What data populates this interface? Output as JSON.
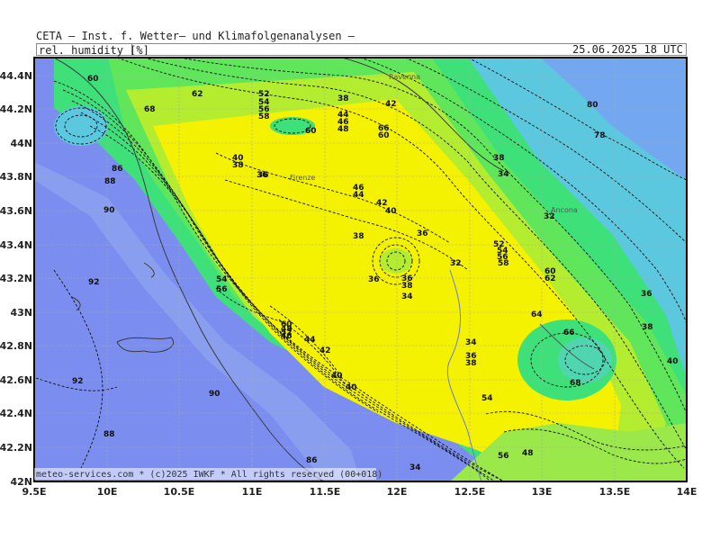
{
  "header": {
    "title": "CETA — Inst. f. Wetter— und Klimafolgenanalysen —",
    "parameter": "rel. humidity [%]",
    "datetime": "25.06.2025 18 UTC"
  },
  "map": {
    "lon_labels": [
      "9.5E",
      "10E",
      "10.5E",
      "11E",
      "11.5E",
      "12E",
      "12.5E",
      "13E",
      "13.5E",
      "14E"
    ],
    "lat_labels": [
      "44.4N",
      "44.2N",
      "44N",
      "43.8N",
      "43.6N",
      "43.4N",
      "43.2N",
      "43N",
      "42.8N",
      "42.6N",
      "42.4N",
      "42.2N",
      "42N"
    ],
    "contour_labels": [
      "60",
      "62",
      "68",
      "52",
      "54",
      "56",
      "58",
      "60",
      "38",
      "42",
      "44",
      "46",
      "48",
      "66",
      "60",
      "80",
      "78",
      "36",
      "40",
      "38",
      "86",
      "88",
      "90",
      "92",
      "46",
      "44",
      "42",
      "40",
      "38",
      "36",
      "38",
      "32",
      "34",
      "36",
      "38",
      "40",
      "52",
      "54",
      "56",
      "58",
      "60",
      "62",
      "64",
      "66",
      "68",
      "92",
      "90",
      "88",
      "86",
      "36",
      "34",
      "32",
      "34",
      "36",
      "38",
      "40",
      "54",
      "56",
      "60",
      "48",
      "54",
      "56",
      "52",
      "36",
      "34",
      "36",
      "38",
      "40",
      "42",
      "44",
      "46",
      "48"
    ],
    "city_labels": [
      "Ravenna",
      "Firenze",
      "Ancona"
    ],
    "copyright": "meteo-services.com * (c)2025 IWKF * All rights reserved (00+018)",
    "colors": {
      "blue": "#7b8ef0",
      "cyan": "#5cc8e0",
      "teal": "#4fd6b0",
      "green": "#3ee07a",
      "lime": "#b4ec30",
      "yellow": "#f4f200",
      "grid": "#aaaaaa",
      "coast": "#3a3a3a"
    }
  }
}
